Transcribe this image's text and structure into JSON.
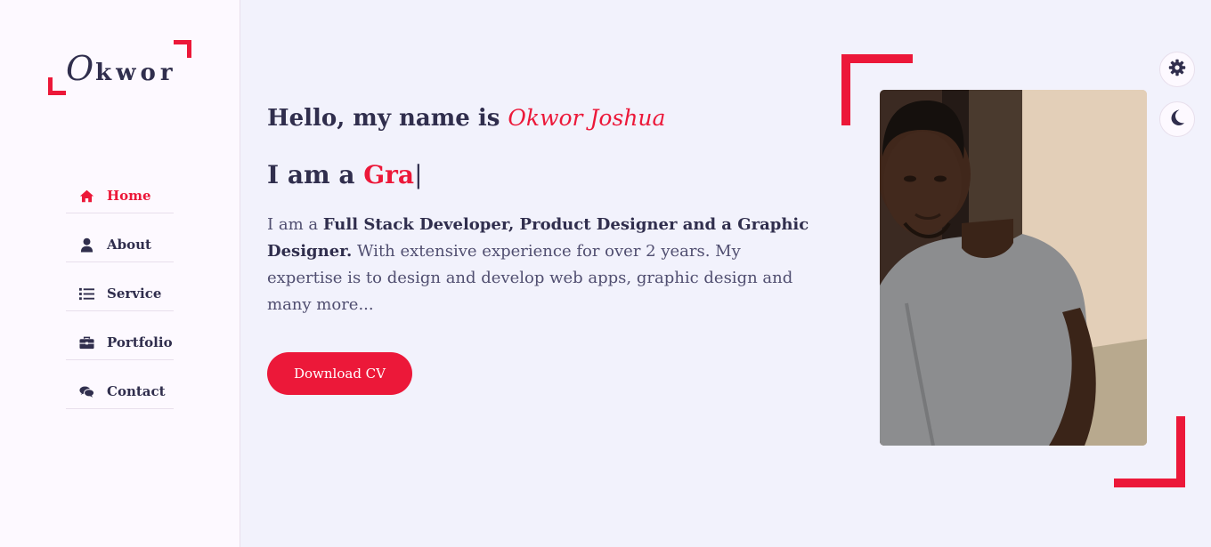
{
  "logo": {
    "first_letter": "O",
    "rest": "kwor"
  },
  "nav": {
    "items": [
      {
        "label": "Home",
        "icon": "home-icon",
        "active": true
      },
      {
        "label": "About",
        "icon": "user-icon",
        "active": false
      },
      {
        "label": "Service",
        "icon": "list-icon",
        "active": false
      },
      {
        "label": "Portfolio",
        "icon": "briefcase-icon",
        "active": false
      },
      {
        "label": "Contact",
        "icon": "comments-icon",
        "active": false
      }
    ]
  },
  "home": {
    "greeting": "Hello, my name is",
    "name": "Okwor Joshua",
    "typing_prefix": "I am a",
    "typing_text": "Gra",
    "typing_cursor": "|",
    "desc_intro": "I am a",
    "desc_bold": "Full Stack Developer, Product Designer and a Graphic Designer.",
    "desc_rest": "With extensive experience for over 2 years. My expertise is to design and develop web apps, graphic design and many more...",
    "cv_button": "Download CV"
  },
  "switcher": {
    "settings_icon": "gear-icon",
    "theme_icon": "moon-icon"
  },
  "colors": {
    "accent": "#ec1839",
    "text": "#302e4d",
    "background": "#f2f2fc",
    "sidebar": "#fdf9ff"
  }
}
